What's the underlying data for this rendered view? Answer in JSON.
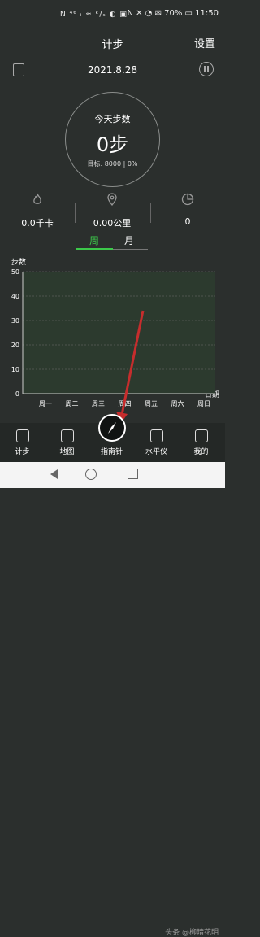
{
  "status": {
    "left_icons": "N ⁴⁶ ᵢ ≈ ᵏ/ₛ ◐ ▣",
    "right_text": "N ✕ ◔ ✉ 70% ▭ 11:50"
  },
  "header": {
    "title": "计步",
    "settings_label": "设置"
  },
  "date": "2021.8.28",
  "today": {
    "label": "今天步数",
    "steps": "0步",
    "goal": "目标:  8000 | 0%"
  },
  "stats": {
    "calories": "0.0千卡",
    "distance": "0.00公里",
    "minutes": "0"
  },
  "tabs": {
    "week": "周",
    "month": "月"
  },
  "chart_data": {
    "type": "bar",
    "title": "",
    "ylabel": "步数",
    "xlabel": "日期",
    "ylim": [
      0,
      50
    ],
    "yticks": [
      "0",
      "10",
      "20",
      "30",
      "40",
      "50"
    ],
    "categories": [
      "周一",
      "周二",
      "周三",
      "周四",
      "周五",
      "周六",
      "周日"
    ],
    "values": [
      0,
      0,
      0,
      0,
      0,
      0,
      0
    ],
    "grid": true
  },
  "nav": {
    "items": [
      {
        "label": "计步",
        "icon": "shoe-icon"
      },
      {
        "label": "地图",
        "icon": "map-icon"
      },
      {
        "label": "指南针",
        "icon": "compass-icon"
      },
      {
        "label": "水平仪",
        "icon": "level-icon"
      },
      {
        "label": "我的",
        "icon": "person-icon"
      }
    ]
  },
  "watermark": "头条 @柳暗花明",
  "colors": {
    "accent": "#3cc84a",
    "background": "#2b2f2d",
    "chart_fill": "#2c3a2e",
    "arrow": "#c62d2d"
  }
}
